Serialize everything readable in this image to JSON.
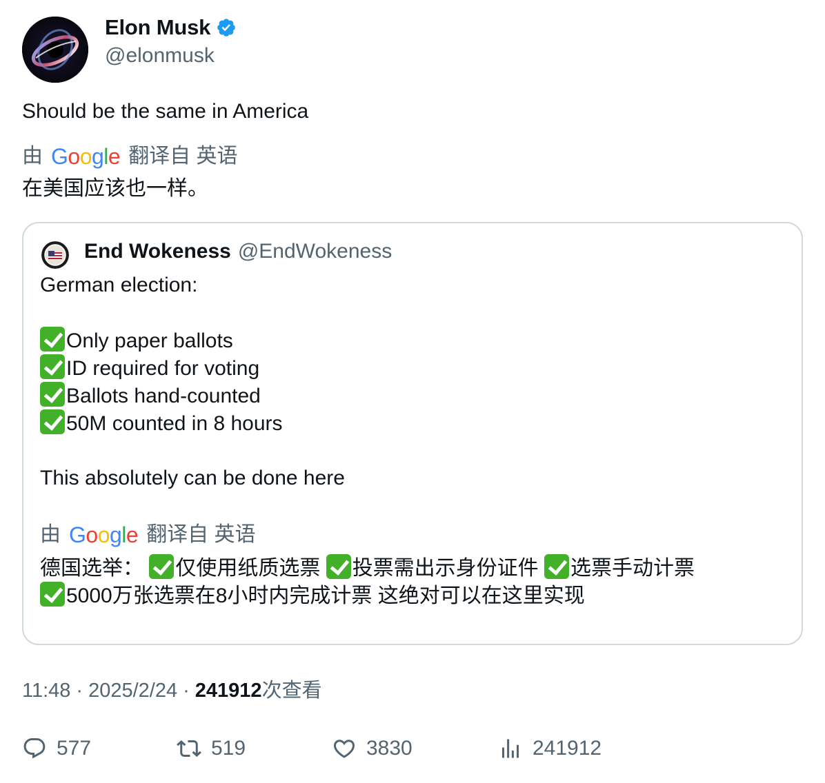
{
  "author": {
    "display_name": "Elon Musk",
    "handle": "@elonmusk",
    "avatar_icon": "blackhole-avatar",
    "verified_icon": "verified-badge-icon"
  },
  "tweet": {
    "text": "Should be the same in America",
    "translated_by_prefix": "由",
    "translated_by_logo": "Google",
    "translated_by_suffix": "翻译自 英语",
    "translated_text": "在美国应该也一样。"
  },
  "quote": {
    "display_name": "End Wokeness",
    "handle": "@EndWokeness",
    "lines": {
      "l0": "German election:",
      "l1": "Only paper ballots",
      "l2": "ID required for voting",
      "l3": "Ballots hand-counted",
      "l4": "50M counted in 8 hours",
      "l5": "This absolutely can be done here"
    },
    "translated_by_prefix": "由",
    "translated_by_logo": "Google",
    "translated_by_suffix": "翻译自 英语",
    "translated": {
      "t0a": "德国选举：",
      "t0b": "仅使用纸质选票",
      "t0c": "投票需出示身份证件",
      "t0d": "选票手动计票",
      "t1a": "5000万张选票在8小时内完成计票 这绝对可以在这里实现"
    }
  },
  "meta": {
    "time": "11:48",
    "separator": "·",
    "date": "2025/2/24",
    "views_count": "241912",
    "views_label": "次查看"
  },
  "actions": {
    "replies": "577",
    "retweets": "519",
    "likes": "3830",
    "views": "241912"
  },
  "colors": {
    "text_primary": "#0f1419",
    "text_secondary": "#536471",
    "verified_blue": "#1d9bf0",
    "border": "#cfd9de",
    "check_green": "#43b02a"
  }
}
